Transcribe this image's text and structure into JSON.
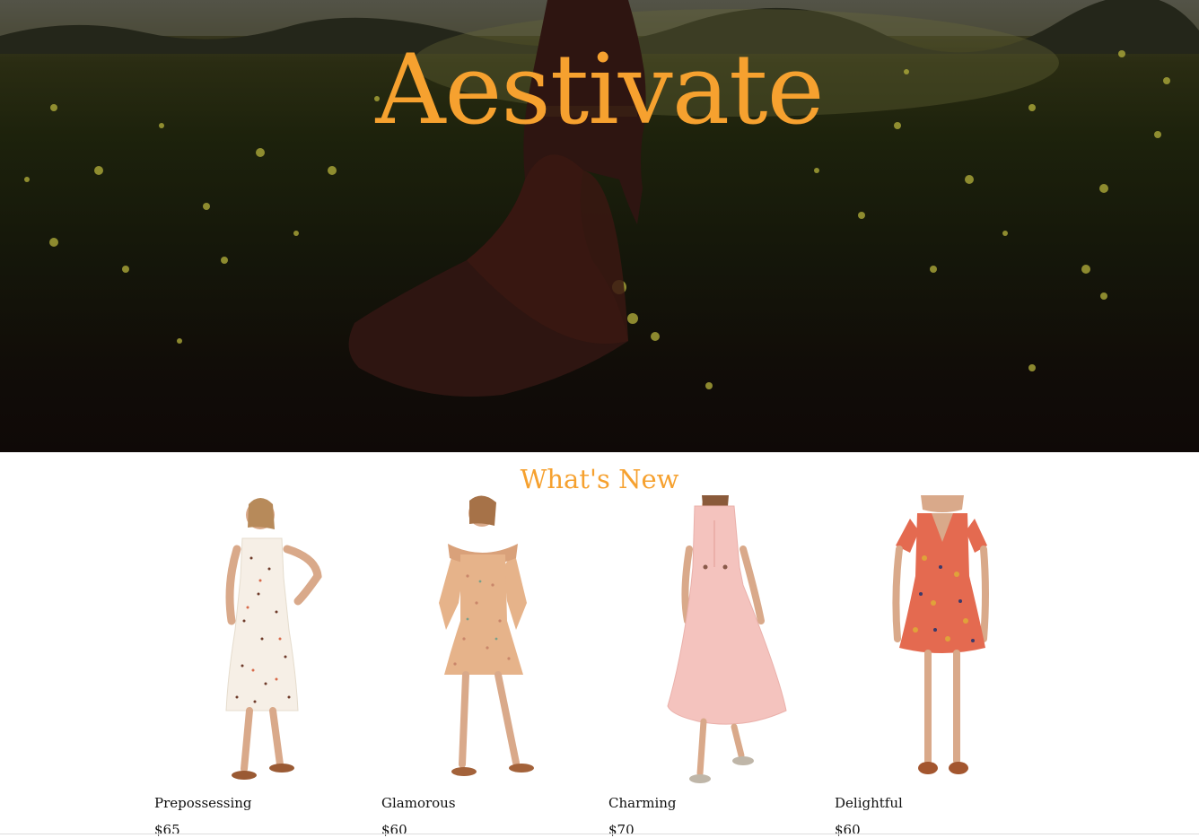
{
  "hero": {
    "title": "Aestivate",
    "title_color": "#f6a12f"
  },
  "new_section": {
    "title": "What's New"
  },
  "products": [
    {
      "name": "Prepossessing",
      "price": "$65",
      "dress_color": "#f6efe6",
      "pattern_color": "#6e3b2a"
    },
    {
      "name": "Glamorous",
      "price": "$60",
      "dress_color": "#e6b38a",
      "pattern_color": "#c9866a"
    },
    {
      "name": "Charming",
      "price": "$70",
      "dress_color": "#f4c3be",
      "pattern_color": "#f4c3be"
    },
    {
      "name": "Delightful",
      "price": "$60",
      "dress_color": "#e46a50",
      "pattern_color": "#e0a23a"
    }
  ]
}
